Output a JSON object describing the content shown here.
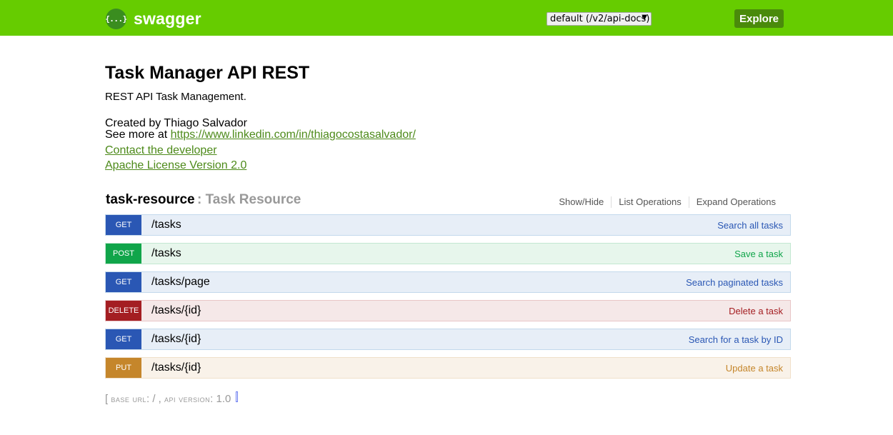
{
  "header": {
    "logo_glyph": "{...}",
    "logo_text": "swagger",
    "spec_select_value": "default (/v2/api-docs)",
    "explore_label": "Explore",
    "bg_color": "#66cc00"
  },
  "info": {
    "title": "Task Manager API REST",
    "description": "REST API Task Management.",
    "created_by": "Created by Thiago Salvador",
    "see_more_prefix": "See more at ",
    "see_more_link": "https://www.linkedin.com/in/thiagocostasalvador/",
    "contact_label": "Contact the developer",
    "license_label": "Apache License Version 2.0"
  },
  "resource": {
    "name": "task-resource",
    "description": ": Task Resource",
    "actions": [
      "Show/Hide",
      "List Operations",
      "Expand Operations"
    ],
    "operations": [
      {
        "method": "GET",
        "path": "/tasks",
        "summary": "Search all tasks"
      },
      {
        "method": "POST",
        "path": "/tasks",
        "summary": "Save a task"
      },
      {
        "method": "GET",
        "path": "/tasks/page",
        "summary": "Search paginated tasks"
      },
      {
        "method": "DELETE",
        "path": "/tasks/{id}",
        "summary": "Delete a task"
      },
      {
        "method": "GET",
        "path": "/tasks/{id}",
        "summary": "Search for a task by ID"
      },
      {
        "method": "PUT",
        "path": "/tasks/{id}",
        "summary": "Update a task"
      }
    ]
  },
  "footer": {
    "open_bracket": "[",
    "base_url_label": "base url",
    "base_url_value": ": / ,",
    "api_version_label": "api version",
    "api_version_value": ": 1.0",
    "close_bracket": "]"
  }
}
